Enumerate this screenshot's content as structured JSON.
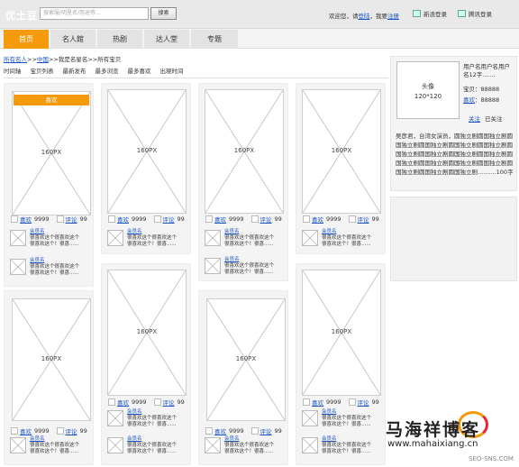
{
  "header": {
    "logo": "优土豆",
    "search_placeholder": "搜索服/明星名/用途等...",
    "search_button": "搜索",
    "welcome_prefix": "欢迎您，请",
    "login": "登陆",
    "welcome_mid": "，我要",
    "register": "注册",
    "sina_login": "新浪登录",
    "qq_login": "腾讯登录"
  },
  "nav": {
    "tabs": [
      "首页",
      "名人館",
      "热剧",
      "达人堂",
      "专题"
    ],
    "active_index": 0,
    "active_color": "#f49a0b"
  },
  "breadcrumb": {
    "items": [
      "所有名人",
      ">>",
      "中国",
      ">>",
      "我是名星名",
      ">>",
      "所有宝贝"
    ]
  },
  "sortbar": {
    "items": [
      "时间轴",
      "宝贝列表",
      "最新发布",
      "最多浏览",
      "最多喜欢",
      "出現时间"
    ]
  },
  "grid": {
    "placeholder_label": "160PX",
    "badge_label": "喜欢",
    "likes_label": "喜欢",
    "likes_count": "9999",
    "comments_label": "评论",
    "comments_count": "99",
    "commenter_name": "会员名",
    "comment_text": "很喜欢这个很喜欢这个很喜欢这个！很喜......"
  },
  "profile": {
    "avatar_label": "头像",
    "avatar_size": "120*120",
    "name": "用户名用户名用户名12字.......",
    "items_label": "宝贝：88888",
    "likes_link": "喜欢",
    "likes_value": "：88888",
    "follow": "关注",
    "followed": "已关注",
    "bio": "吴彦君，台湾女演员，圆独立剧圆国独立剧圆国独立剧圆国独立剧圆国独立剧圆国独立剧圆国独立剧圆国独立剧圆国独立剧圆国独立剧圆国独立剧圆国独立剧圆国独立剧圆国独立剧圆国独立剧圆国独立剧圆国独立剧..........100字"
  },
  "watermark": {
    "title": "马海祥博客",
    "url": "www.mahaixiang.cn",
    "sub": "SEO-SNS.COM"
  }
}
